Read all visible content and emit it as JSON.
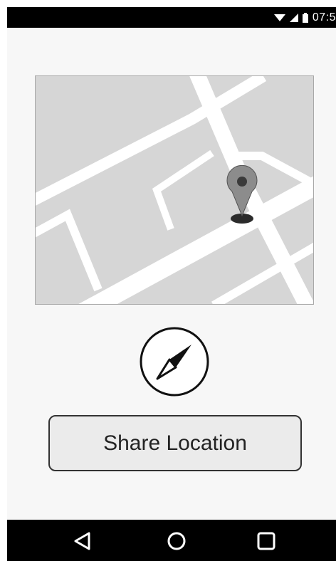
{
  "status_bar": {
    "time": "07:5",
    "icons": [
      "wifi-icon",
      "signal-icon",
      "battery-icon"
    ]
  },
  "map": {
    "background": "#d6d6d6",
    "road_color": "#ffffff",
    "pin_color": "#8c8c8c",
    "pin_shadow_color": "#2b2b2b"
  },
  "compass": {
    "icon": "compass-icon"
  },
  "share_button": {
    "label": "Share Location"
  },
  "nav_bar": {
    "back": "back-icon",
    "home": "home-icon",
    "recents": "recents-icon"
  }
}
